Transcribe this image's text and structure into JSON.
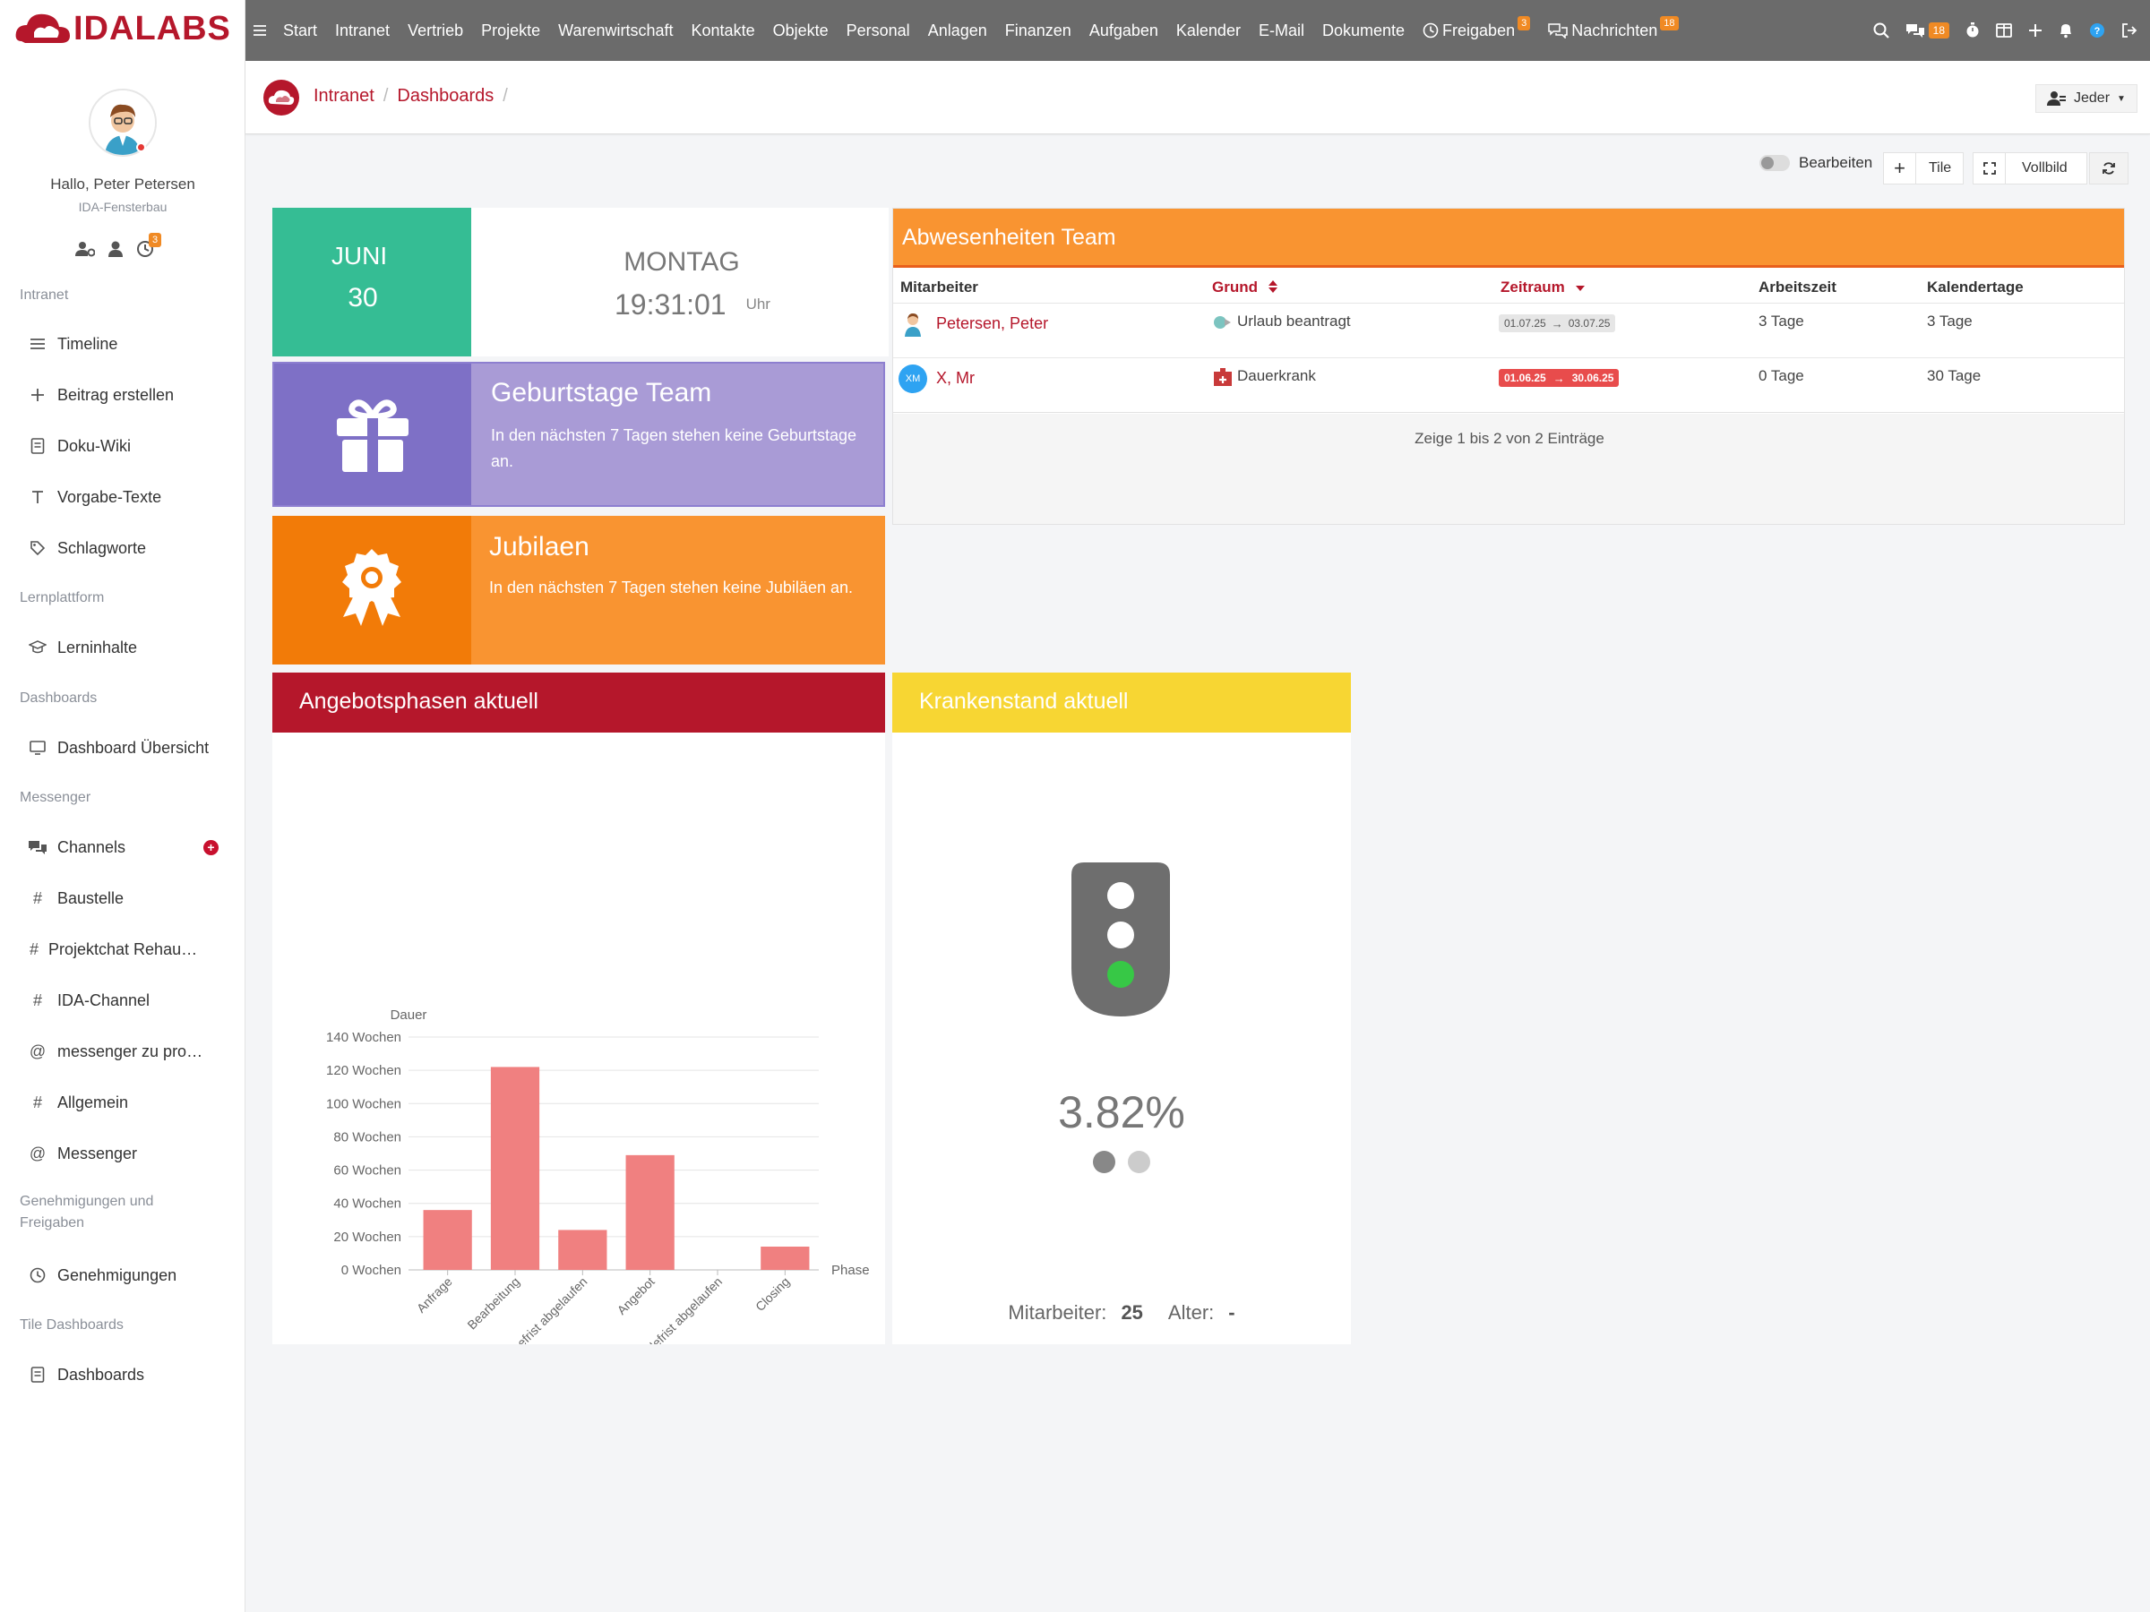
{
  "app": {
    "logo_text": "IDALABS"
  },
  "topnav": {
    "items": [
      "Start",
      "Intranet",
      "Vertrieb",
      "Projekte",
      "Warenwirtschaft",
      "Kontakte",
      "Objekte",
      "Personal",
      "Anlagen",
      "Finanzen",
      "Aufgaben",
      "Kalender",
      "E-Mail",
      "Dokumente"
    ],
    "freigaben_label": "Freigaben",
    "freigaben_badge": "3",
    "nachrichten_label": "Nachrichten",
    "nachrichten_badge": "18",
    "chat_badge": "18"
  },
  "user": {
    "greeting": "Hallo, Peter Petersen",
    "company": "IDA-Fensterbau",
    "approvals_badge": "3"
  },
  "sidebar": {
    "sections": {
      "intranet": "Intranet",
      "lernplattform": "Lernplattform",
      "dashboards": "Dashboards",
      "messenger": "Messenger",
      "genehmigungen": "Genehmigungen und Freigaben",
      "tile_dashboards": "Tile Dashboards"
    },
    "items": {
      "timeline": "Timeline",
      "beitrag": "Beitrag erstellen",
      "doku_wiki": "Doku-Wiki",
      "vorgabe": "Vorgabe-Texte",
      "schlagworte": "Schlagworte",
      "lerninhalte": "Lerninhalte",
      "dashboard_uebersicht": "Dashboard Übersicht",
      "channels": "Channels",
      "baustelle": "Baustelle",
      "projektchat": "Projektchat Rehau…",
      "ida_channel": "IDA-Channel",
      "messenger_zu": "messenger zu pro…",
      "allgemein": "Allgemein",
      "messenger": "Messenger",
      "genehmigungen": "Genehmigungen",
      "dashboards": "Dashboards"
    }
  },
  "breadcrumb": {
    "intranet": "Intranet",
    "sep": "/",
    "dashboards": "Dashboards"
  },
  "viewer": {
    "label": "Jeder"
  },
  "toolbar": {
    "edit_label": "Bearbeiten",
    "tile_label": "Tile",
    "fullscreen_label": "Vollbild"
  },
  "date_tile": {
    "month": "JUNI",
    "day": "30",
    "weekday": "MONTAG",
    "time": "19:31:01",
    "time_unit": "Uhr"
  },
  "birthdays": {
    "title": "Geburtstage Team",
    "text": "In den nächsten 7 Tagen stehen keine Geburtstage an."
  },
  "jubilees": {
    "title": "Jubilaen",
    "text": "In den nächsten 7 Tagen stehen keine Jubiläen an."
  },
  "absences": {
    "title": "Abwesenheiten Team",
    "columns": [
      "Mitarbeiter",
      "Grund",
      "Zeitraum",
      "Arbeitszeit",
      "Kalendertage"
    ],
    "rows": [
      {
        "name": "Petersen, Peter",
        "reason": "Urlaub beantragt",
        "from": "01.07.25",
        "to": "03.07.25",
        "worktime": "3 Tage",
        "caldays": "3 Tage"
      },
      {
        "name": "X, Mr",
        "initials": "XM",
        "reason": "Dauerkrank",
        "from": "01.06.25",
        "to": "30.06.25",
        "worktime": "0 Tage",
        "caldays": "30 Tage"
      }
    ],
    "footer": "Zeige 1 bis 2 von 2 Einträge"
  },
  "offers": {
    "title": "Angebotsphasen aktuell"
  },
  "chart_data": {
    "type": "bar",
    "categories": [
      "Anfrage",
      "Bearbeitung",
      "Abgabefrist abgelaufen",
      "Angebot",
      "Bindefrist abgelaufen",
      "Closing"
    ],
    "values": [
      36,
      122,
      24,
      69,
      0,
      14
    ],
    "ylabel": "Dauer",
    "xlabel": "Phase",
    "ylim": [
      0,
      140
    ],
    "yticks": [
      0,
      20,
      40,
      60,
      80,
      100,
      120,
      140
    ],
    "tick_suffix": " Wochen",
    "color": "#f08080",
    "grid": true
  },
  "sick": {
    "title": "Krankenstand aktuell",
    "percent": "3.82%",
    "employees_label": "Mitarbeiter:",
    "employees_value": "25",
    "age_label": "Alter:",
    "age_value": "-"
  },
  "colors": {
    "brand": "#b5172b",
    "teal": "#35bd94",
    "purple": "#a99bd6",
    "orange": "#f48a2a",
    "yellow": "#f7d633",
    "topbar": "#6b6b6b"
  }
}
